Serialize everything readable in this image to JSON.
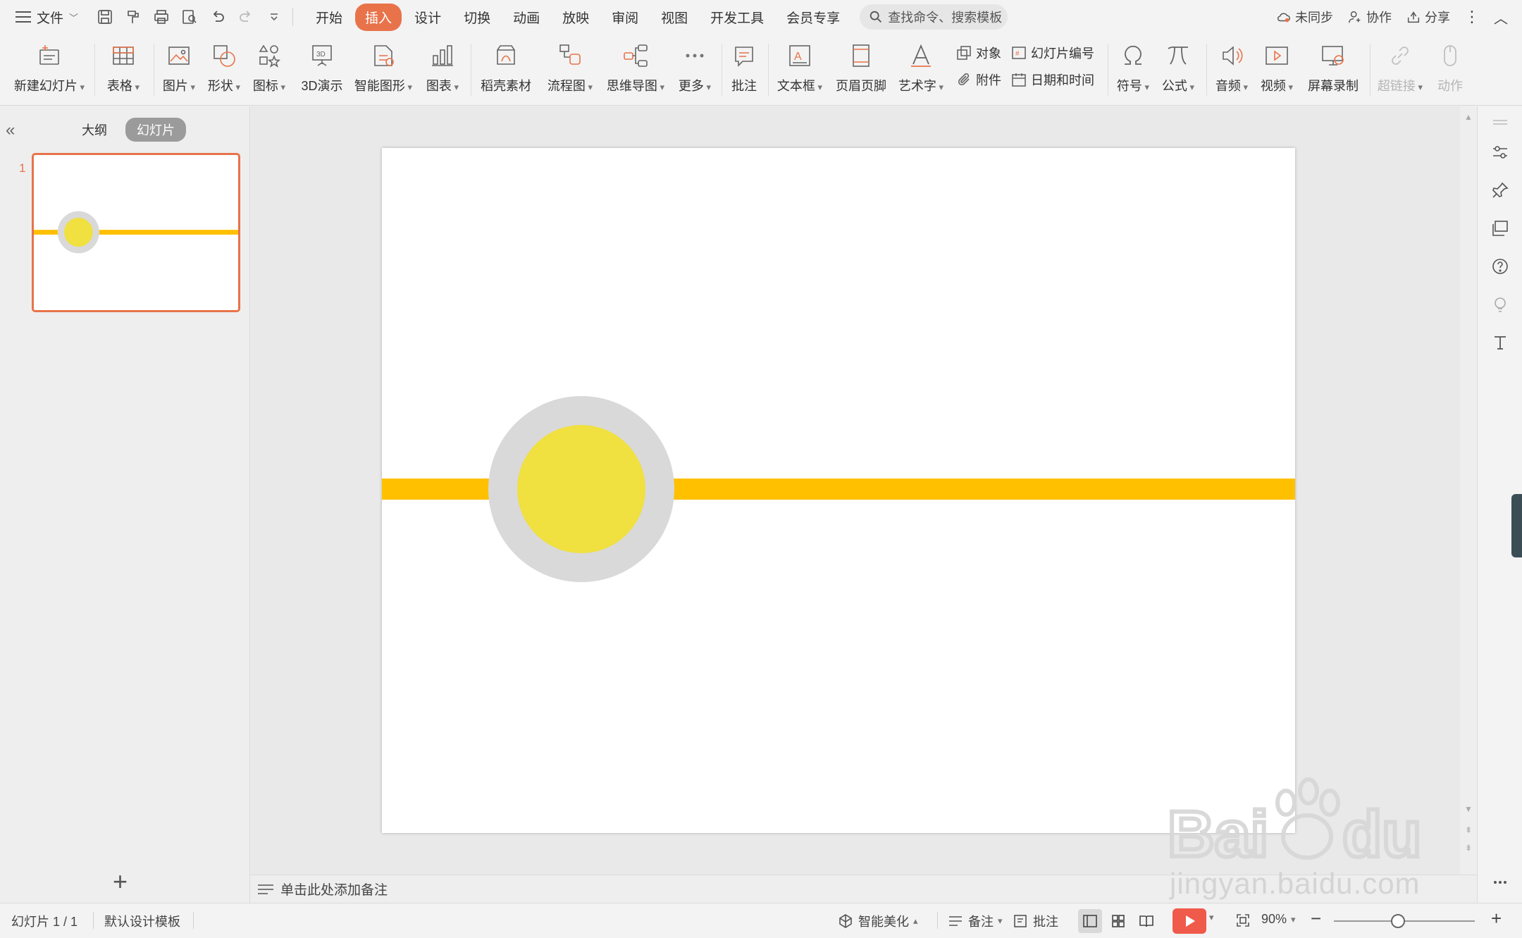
{
  "menubar": {
    "file_label": "文件",
    "tabs": [
      "开始",
      "插入",
      "设计",
      "切换",
      "动画",
      "放映",
      "审阅",
      "视图",
      "开发工具",
      "会员专享"
    ],
    "active_tab": "插入",
    "search_placeholder": "查找命令、搜索模板",
    "sync_label": "未同步",
    "collab_label": "协作",
    "share_label": "分享"
  },
  "ribbon": {
    "new_slide": "新建幻灯片",
    "table": "表格",
    "picture": "图片",
    "shape": "形状",
    "icon": "图标",
    "demo3d": "3D演示",
    "smartart": "智能图形",
    "chart": "图表",
    "daoke": "稻壳素材",
    "flowchart": "流程图",
    "mindmap": "思维导图",
    "more": "更多",
    "comment": "批注",
    "textbox": "文本框",
    "header_footer": "页眉页脚",
    "wordart": "艺术字",
    "object": "对象",
    "slide_number": "幻灯片编号",
    "attachment": "附件",
    "datetime": "日期和时间",
    "symbol": "符号",
    "formula": "公式",
    "audio": "音频",
    "video": "视频",
    "screen_record": "屏幕录制",
    "hyperlink": "超链接",
    "action": "动作"
  },
  "leftpanel": {
    "outline_tab": "大纲",
    "slides_tab": "幻灯片",
    "slide_number": "1",
    "add_slide": "+"
  },
  "notes_placeholder": "单击此处添加备注",
  "slide": {
    "line_color": "#ffc000",
    "outer_circle_color": "#d9d9d9",
    "inner_circle_color": "#f0e040"
  },
  "statusbar": {
    "slide_info": "幻灯片 1 / 1",
    "template": "默认设计模板",
    "beautify": "智能美化",
    "notes": "备注",
    "comments": "批注",
    "zoom": "90%",
    "zoom_out": "−",
    "zoom_in": "+"
  },
  "watermark": {
    "url": "jingyan.baidu.com"
  },
  "colors": {
    "accent": "#e8734a",
    "play": "#f05a4a"
  }
}
